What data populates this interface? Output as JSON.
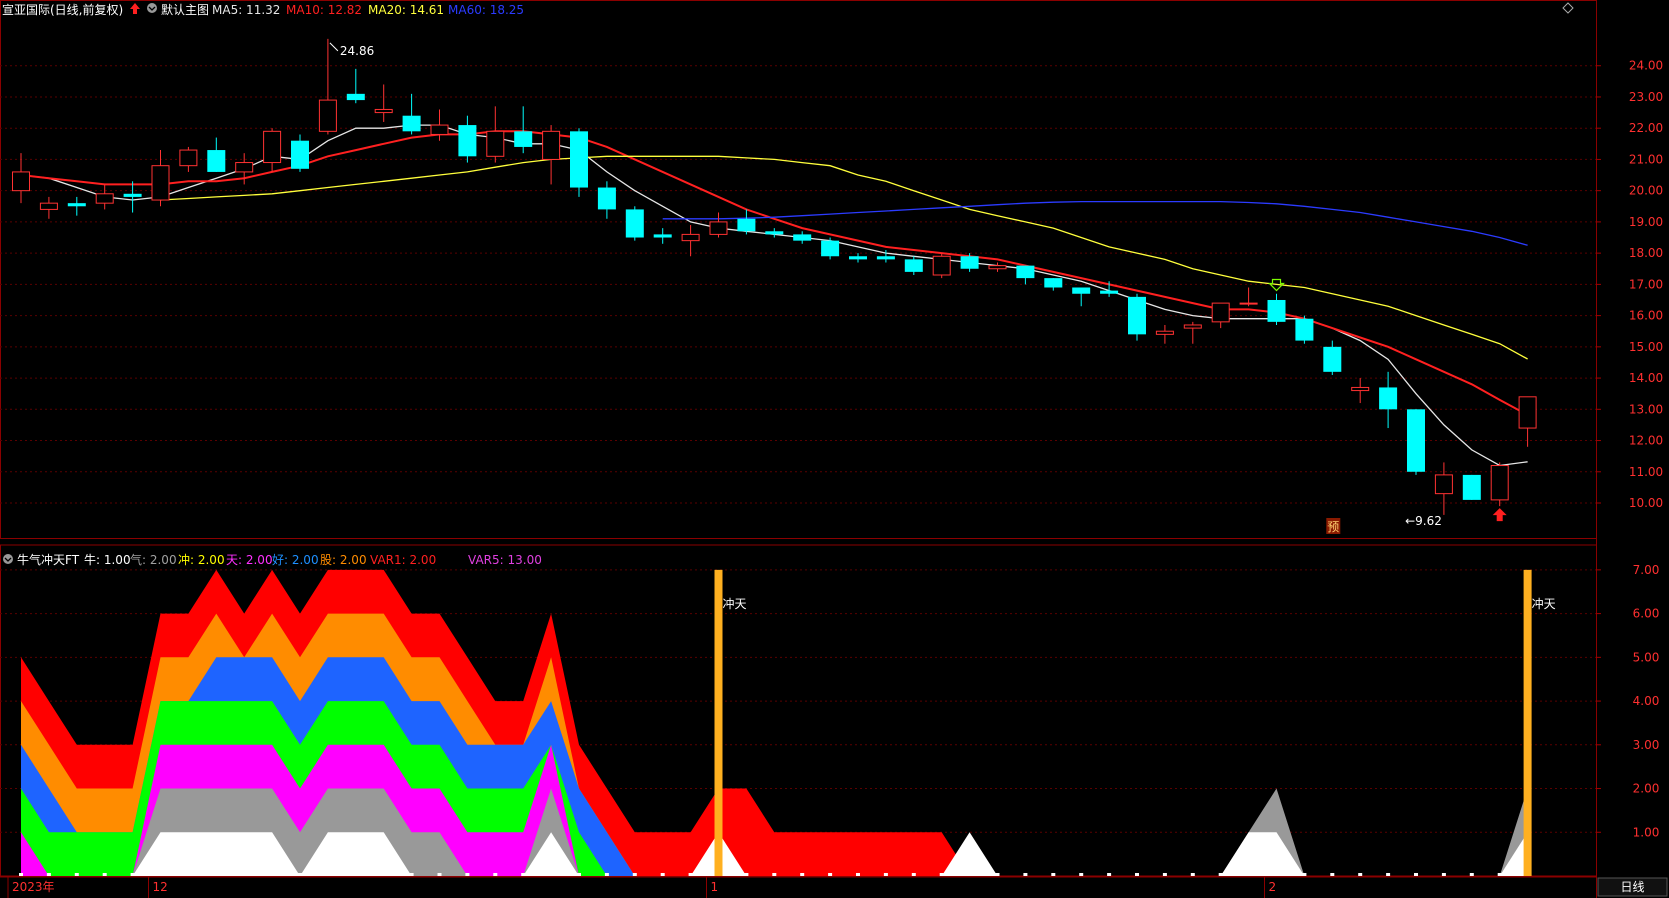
{
  "header": {
    "stock_title": "宣亚国际(日线,前复权)",
    "main_chart_label": "默认主图",
    "ma_labels": [
      {
        "text": "MA5: 11.32",
        "color": "#e6e6e6"
      },
      {
        "text": "MA10: 12.82",
        "color": "#ff2020"
      },
      {
        "text": "MA20: 14.61",
        "color": "#ffff3c"
      },
      {
        "text": "MA60: 18.25",
        "color": "#2b3bff"
      }
    ]
  },
  "sub_header": {
    "indicator_name": "牛气冲天FT",
    "values": [
      {
        "text": "牛: 1.00",
        "color": "#ffffff"
      },
      {
        "text": "气: 2.00",
        "color": "#a0a0a0"
      },
      {
        "text": "冲: 2.00",
        "color": "#ffff00"
      },
      {
        "text": "天: 2.00",
        "color": "#ff30ff"
      },
      {
        "text": "好: 2.00",
        "color": "#1e90ff"
      },
      {
        "text": "股: 2.00",
        "color": "#ff8c00"
      },
      {
        "text": "VAR1: 2.00",
        "color": "#ff2020"
      },
      {
        "text": "VAR5: 13.00",
        "color": "#e040e0"
      }
    ]
  },
  "annotations": {
    "high_label": "24.86",
    "low_label": "9.62",
    "pre_badge": "预",
    "chongtian_label": "冲天"
  },
  "bottom_axis": {
    "labels": [
      "2023年",
      "12",
      "1",
      "2"
    ],
    "period_button": "日线"
  },
  "chart_data": [
    {
      "type": "candlestick",
      "title": "宣亚国际(日线,前复权)",
      "ylim": [
        9.2,
        25.4
      ],
      "yticks": [
        "24.00",
        "23.00",
        "22.00",
        "21.00",
        "20.00",
        "19.00",
        "18.00",
        "17.00",
        "16.00",
        "15.00",
        "14.00",
        "13.00",
        "12.00",
        "11.00",
        "10.00"
      ],
      "candles": [
        {
          "o": 20.0,
          "h": 21.2,
          "l": 19.6,
          "c": 20.6
        },
        {
          "o": 19.4,
          "h": 19.8,
          "l": 19.1,
          "c": 19.6
        },
        {
          "o": 19.6,
          "h": 19.8,
          "l": 19.2,
          "c": 19.5
        },
        {
          "o": 19.6,
          "h": 20.2,
          "l": 19.4,
          "c": 19.9
        },
        {
          "o": 19.9,
          "h": 20.3,
          "l": 19.3,
          "c": 19.8
        },
        {
          "o": 19.7,
          "h": 21.3,
          "l": 19.5,
          "c": 20.8
        },
        {
          "o": 20.8,
          "h": 21.4,
          "l": 20.6,
          "c": 21.3
        },
        {
          "o": 21.3,
          "h": 21.7,
          "l": 20.6,
          "c": 20.6
        },
        {
          "o": 20.6,
          "h": 21.2,
          "l": 20.2,
          "c": 20.9
        },
        {
          "o": 20.9,
          "h": 22.0,
          "l": 20.6,
          "c": 21.9
        },
        {
          "o": 21.6,
          "h": 21.8,
          "l": 20.6,
          "c": 20.7
        },
        {
          "o": 21.9,
          "h": 24.86,
          "l": 21.8,
          "c": 22.9
        },
        {
          "o": 23.1,
          "h": 23.9,
          "l": 22.8,
          "c": 22.9
        },
        {
          "o": 22.5,
          "h": 23.4,
          "l": 22.2,
          "c": 22.6
        },
        {
          "o": 22.4,
          "h": 23.1,
          "l": 21.8,
          "c": 21.9
        },
        {
          "o": 21.8,
          "h": 22.6,
          "l": 21.6,
          "c": 22.1
        },
        {
          "o": 22.1,
          "h": 22.4,
          "l": 20.9,
          "c": 21.1
        },
        {
          "o": 21.1,
          "h": 22.7,
          "l": 20.9,
          "c": 21.9
        },
        {
          "o": 21.9,
          "h": 22.7,
          "l": 21.2,
          "c": 21.4
        },
        {
          "o": 21.0,
          "h": 22.1,
          "l": 20.2,
          "c": 21.9
        },
        {
          "o": 21.9,
          "h": 22.0,
          "l": 19.8,
          "c": 20.1
        },
        {
          "o": 20.1,
          "h": 20.3,
          "l": 19.1,
          "c": 19.4
        },
        {
          "o": 19.4,
          "h": 19.5,
          "l": 18.4,
          "c": 18.5
        },
        {
          "o": 18.6,
          "h": 18.8,
          "l": 18.3,
          "c": 18.5
        },
        {
          "o": 18.4,
          "h": 18.9,
          "l": 17.9,
          "c": 18.6
        },
        {
          "o": 18.6,
          "h": 19.3,
          "l": 18.5,
          "c": 19.0
        },
        {
          "o": 19.1,
          "h": 19.4,
          "l": 18.6,
          "c": 18.7
        },
        {
          "o": 18.7,
          "h": 18.8,
          "l": 18.5,
          "c": 18.6
        },
        {
          "o": 18.6,
          "h": 18.7,
          "l": 18.3,
          "c": 18.4
        },
        {
          "o": 18.4,
          "h": 18.5,
          "l": 17.8,
          "c": 17.9
        },
        {
          "o": 17.9,
          "h": 18.0,
          "l": 17.7,
          "c": 17.8
        },
        {
          "o": 17.9,
          "h": 18.1,
          "l": 17.7,
          "c": 17.8
        },
        {
          "o": 17.8,
          "h": 17.9,
          "l": 17.3,
          "c": 17.4
        },
        {
          "o": 17.3,
          "h": 18.0,
          "l": 17.2,
          "c": 17.9
        },
        {
          "o": 17.9,
          "h": 18.0,
          "l": 17.4,
          "c": 17.5
        },
        {
          "o": 17.5,
          "h": 17.7,
          "l": 17.4,
          "c": 17.6
        },
        {
          "o": 17.6,
          "h": 17.6,
          "l": 17.0,
          "c": 17.2
        },
        {
          "o": 17.2,
          "h": 17.2,
          "l": 16.8,
          "c": 16.9
        },
        {
          "o": 16.9,
          "h": 16.9,
          "l": 16.3,
          "c": 16.7
        },
        {
          "o": 16.8,
          "h": 17.1,
          "l": 16.6,
          "c": 16.7
        },
        {
          "o": 16.6,
          "h": 16.7,
          "l": 15.2,
          "c": 15.4
        },
        {
          "o": 15.4,
          "h": 15.7,
          "l": 15.1,
          "c": 15.5
        },
        {
          "o": 15.6,
          "h": 15.8,
          "l": 15.1,
          "c": 15.7
        },
        {
          "o": 15.8,
          "h": 16.4,
          "l": 15.6,
          "c": 16.4
        },
        {
          "o": 16.4,
          "h": 16.9,
          "l": 16.3,
          "c": 16.4
        },
        {
          "o": 16.5,
          "h": 16.7,
          "l": 15.7,
          "c": 15.8
        },
        {
          "o": 15.9,
          "h": 16.0,
          "l": 15.1,
          "c": 15.2
        },
        {
          "o": 15.0,
          "h": 15.2,
          "l": 14.1,
          "c": 14.2
        },
        {
          "o": 13.6,
          "h": 14.0,
          "l": 13.2,
          "c": 13.7
        },
        {
          "o": 13.7,
          "h": 14.2,
          "l": 12.4,
          "c": 13.0
        },
        {
          "o": 13.0,
          "h": 13.0,
          "l": 10.9,
          "c": 11.0
        },
        {
          "o": 10.3,
          "h": 11.3,
          "l": 9.62,
          "c": 10.9
        },
        {
          "o": 10.9,
          "h": 10.9,
          "l": 10.1,
          "c": 10.1
        },
        {
          "o": 10.1,
          "h": 11.3,
          "l": 9.9,
          "c": 11.2
        },
        {
          "o": 12.4,
          "h": 13.4,
          "l": 11.8,
          "c": 13.4
        }
      ],
      "ma": [
        {
          "name": "MA5",
          "color": "#e6e6e6",
          "values": [
            20.5,
            20.4,
            20.1,
            19.8,
            19.7,
            19.8,
            20.1,
            20.4,
            20.7,
            21.1,
            21.0,
            21.6,
            22.0,
            22.0,
            22.1,
            22.1,
            21.8,
            21.7,
            21.5,
            21.5,
            21.3,
            20.6,
            20.0,
            19.5,
            19.0,
            18.8,
            18.7,
            18.6,
            18.5,
            18.4,
            18.2,
            18.0,
            17.9,
            17.8,
            17.7,
            17.6,
            17.5,
            17.3,
            17.1,
            16.8,
            16.5,
            16.2,
            16.0,
            15.9,
            15.9,
            15.9,
            15.9,
            15.6,
            15.2,
            14.6,
            13.5,
            12.5,
            11.7,
            11.2,
            11.32
          ]
        },
        {
          "name": "MA10",
          "color": "#ff2020",
          "values": [
            20.5,
            20.4,
            20.3,
            20.2,
            20.2,
            20.2,
            20.3,
            20.3,
            20.4,
            20.6,
            20.8,
            21.1,
            21.3,
            21.5,
            21.7,
            21.8,
            21.8,
            21.9,
            21.9,
            21.8,
            21.7,
            21.4,
            21.0,
            20.6,
            20.2,
            19.8,
            19.4,
            19.1,
            18.8,
            18.6,
            18.4,
            18.2,
            18.1,
            18.0,
            17.9,
            17.8,
            17.6,
            17.4,
            17.2,
            17.0,
            16.8,
            16.6,
            16.4,
            16.2,
            16.2,
            16.1,
            15.9,
            15.6,
            15.3,
            15.0,
            14.6,
            14.2,
            13.8,
            13.3,
            12.82
          ]
        },
        {
          "name": "MA20",
          "color": "#ffff3c",
          "values": [
            19.7,
            19.75,
            19.8,
            19.85,
            19.9,
            20.0,
            20.1,
            20.2,
            20.3,
            20.4,
            20.5,
            20.6,
            20.75,
            20.9,
            21.0,
            21.05,
            21.1,
            21.1,
            21.1,
            21.1,
            21.1,
            21.05,
            21.0,
            20.9,
            20.8,
            20.5,
            20.3,
            20.0,
            19.7,
            19.4,
            19.2,
            19.0,
            18.8,
            18.5,
            18.2,
            18.0,
            17.8,
            17.5,
            17.3,
            17.1,
            17.0,
            16.9,
            16.7,
            16.5,
            16.3,
            16.0,
            15.7,
            15.4,
            15.1,
            14.61
          ]
        },
        {
          "name": "MA60",
          "color": "#2b3bff",
          "values": [
            19.1,
            19.1,
            19.1,
            19.12,
            19.15,
            19.2,
            19.25,
            19.3,
            19.35,
            19.4,
            19.45,
            19.5,
            19.55,
            19.6,
            19.63,
            19.65,
            19.65,
            19.65,
            19.65,
            19.65,
            19.65,
            19.62,
            19.58,
            19.5,
            19.4,
            19.3,
            19.15,
            19.0,
            18.85,
            18.7,
            18.5,
            18.25
          ]
        }
      ]
    },
    {
      "type": "area",
      "title": "牛气冲天FT",
      "ylim": [
        0,
        7.5
      ],
      "yticks": [
        "7.00",
        "6.00",
        "5.00",
        "4.00",
        "3.00",
        "2.00",
        "1.00"
      ],
      "series": [
        {
          "name": "VAR1",
          "color": "#ff0000",
          "values": [
            5,
            4,
            3,
            3,
            3,
            6,
            6,
            7,
            6,
            7,
            6,
            7,
            7,
            7,
            6,
            6,
            5,
            4,
            4,
            6,
            3,
            2,
            1,
            1,
            1,
            2,
            2,
            1,
            1,
            1,
            1,
            1,
            1,
            1,
            0,
            0,
            0,
            0,
            0,
            0,
            0,
            0,
            0,
            0,
            0,
            0,
            0,
            0,
            0,
            0,
            0,
            0,
            0,
            0,
            0
          ]
        },
        {
          "name": "股",
          "color": "#ff8c00",
          "values": [
            4,
            3,
            2,
            2,
            2,
            5,
            5,
            6,
            5,
            6,
            5,
            6,
            6,
            6,
            5,
            5,
            4,
            3,
            3,
            5,
            2,
            1,
            0,
            0,
            0,
            0,
            0,
            0,
            0,
            0,
            0,
            0,
            0,
            0,
            0,
            0,
            0,
            0,
            0,
            0,
            0,
            0,
            0,
            0,
            0,
            0,
            0,
            0,
            0,
            0,
            0,
            0,
            0,
            0,
            0
          ]
        },
        {
          "name": "好",
          "color": "#1e64ff",
          "values": [
            3,
            2,
            1,
            1,
            1,
            4,
            4,
            5,
            5,
            5,
            4,
            5,
            5,
            5,
            4,
            4,
            3,
            3,
            3,
            4,
            2,
            1,
            0,
            0,
            0,
            0,
            0,
            0,
            0,
            0,
            0,
            0,
            0,
            0,
            0,
            0,
            0,
            0,
            0,
            0,
            0,
            0,
            0,
            0,
            0,
            0,
            0,
            0,
            0,
            0,
            0,
            0,
            0,
            0,
            0
          ]
        },
        {
          "name": "天",
          "color": "#00ff00",
          "values": [
            2,
            1,
            1,
            1,
            1,
            4,
            4,
            4,
            4,
            4,
            3,
            4,
            4,
            4,
            3,
            3,
            2,
            2,
            2,
            3,
            1,
            0,
            0,
            0,
            0,
            0,
            0,
            0,
            0,
            0,
            0,
            0,
            0,
            0,
            0,
            0,
            0,
            0,
            0,
            0,
            0,
            0,
            0,
            0,
            0,
            0,
            0,
            0,
            0,
            0,
            0,
            0,
            0,
            0,
            0
          ]
        },
        {
          "name": "冲",
          "color": "#ff00ff",
          "values": [
            1,
            0,
            0,
            0,
            0,
            3,
            3,
            3,
            3,
            3,
            2,
            3,
            3,
            3,
            2,
            2,
            1,
            1,
            1,
            3,
            0,
            0,
            0,
            0,
            0,
            0,
            0,
            0,
            0,
            0,
            0,
            0,
            0,
            0,
            0,
            0,
            0,
            0,
            0,
            0,
            0,
            0,
            0,
            0,
            0,
            0,
            0,
            0,
            0,
            0,
            0,
            0,
            0,
            0,
            0
          ]
        },
        {
          "name": "气",
          "color": "#999999",
          "values": [
            0,
            0,
            0,
            0,
            0,
            2,
            2,
            2,
            2,
            2,
            1,
            2,
            2,
            2,
            1,
            1,
            0,
            0,
            0,
            2,
            0,
            0,
            0,
            0,
            0,
            0,
            0,
            0,
            0,
            0,
            0,
            0,
            0,
            0,
            0,
            0,
            0,
            0,
            0,
            0,
            0,
            0,
            0,
            0,
            1,
            2,
            0,
            0,
            0,
            0,
            0,
            0,
            0,
            0,
            2
          ]
        },
        {
          "name": "牛",
          "color": "#ffffff",
          "values": [
            0,
            0,
            0,
            0,
            0,
            1,
            1,
            1,
            1,
            1,
            0,
            1,
            1,
            1,
            0,
            0,
            0,
            0,
            0,
            1,
            0,
            0,
            0,
            0,
            0,
            1,
            0,
            0,
            0,
            0,
            0,
            0,
            0,
            0,
            1,
            0,
            0,
            0,
            0,
            0,
            0,
            0,
            0,
            0,
            1,
            1,
            0,
            0,
            0,
            0,
            0,
            0,
            0,
            0,
            1
          ]
        }
      ],
      "signals": [
        {
          "index": 25,
          "value": 7.0
        },
        {
          "index": 54,
          "value": 7.0
        }
      ]
    }
  ]
}
